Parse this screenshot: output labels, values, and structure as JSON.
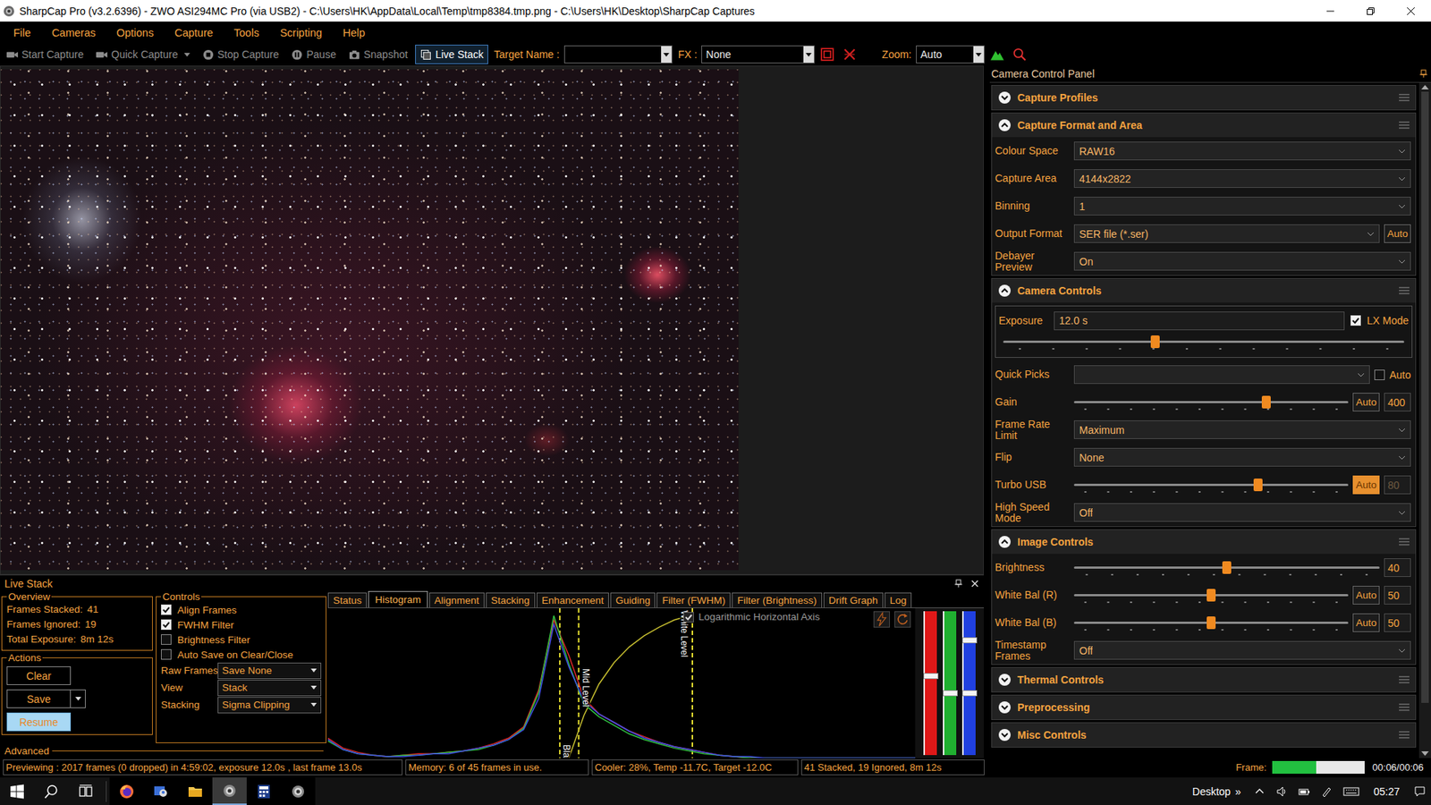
{
  "window": {
    "title": "SharpCap Pro (v3.2.6396) - ZWO ASI294MC Pro (via USB2) - C:\\Users\\HK\\AppData\\Local\\Temp\\tmp8384.tmp.png - C:\\Users\\HK\\Desktop\\SharpCap Captures"
  },
  "menu": [
    "File",
    "Cameras",
    "Options",
    "Capture",
    "Tools",
    "Scripting",
    "Help"
  ],
  "toolbar": {
    "buttons": [
      {
        "label": "Start Capture",
        "kind": "camera",
        "disabled": true,
        "selected": false,
        "dropdown": false
      },
      {
        "label": "Quick Capture",
        "kind": "camera",
        "disabled": true,
        "selected": false,
        "dropdown": true
      },
      {
        "label": "Stop Capture",
        "kind": "stop",
        "disabled": true,
        "selected": false,
        "dropdown": false
      },
      {
        "label": "Pause",
        "kind": "pause",
        "disabled": true,
        "selected": false,
        "dropdown": false
      },
      {
        "label": "Snapshot",
        "kind": "snapshot",
        "disabled": true,
        "selected": false,
        "dropdown": false
      },
      {
        "label": "Live Stack",
        "kind": "stack",
        "disabled": false,
        "selected": true,
        "dropdown": false
      }
    ],
    "target": {
      "label": "Target Name :",
      "value": ""
    },
    "fx": {
      "label": "FX :",
      "value": "None"
    },
    "zoom": {
      "label": "Zoom:",
      "value": "Auto"
    }
  },
  "control_panel": {
    "title": "Camera Control Panel",
    "scroll": {
      "level": 0.93
    },
    "sections": [
      {
        "title": "Capture Profiles",
        "expanded": false,
        "rows": []
      },
      {
        "title": "Capture Format and Area",
        "expanded": true,
        "rows": [
          {
            "kind": "select",
            "label": "Colour Space",
            "value": "RAW16"
          },
          {
            "kind": "select",
            "label": "Capture Area",
            "value": "4144x2822"
          },
          {
            "kind": "select",
            "label": "Binning",
            "value": "1"
          },
          {
            "kind": "select",
            "label": "Output Format",
            "value": "SER file (*.ser)",
            "button": "Auto"
          },
          {
            "kind": "select",
            "label": "Debayer Preview",
            "value": "On"
          }
        ]
      },
      {
        "title": "Camera Controls",
        "expanded": true,
        "rows": [
          {
            "kind": "exposure",
            "label": "Exposure",
            "value": "12.0 s",
            "check_label": "LX Mode",
            "checked": true,
            "level": 0.38
          },
          {
            "kind": "quickpicks",
            "label": "Quick Picks",
            "value": "",
            "check_label": "Auto",
            "checked": false
          },
          {
            "kind": "slider",
            "label": "Gain",
            "level": 0.7,
            "button": "Auto",
            "button_on": false,
            "value": "400",
            "disabled": false
          },
          {
            "kind": "select",
            "label": "Frame Rate Limit",
            "value": "Maximum"
          },
          {
            "kind": "select",
            "label": "Flip",
            "value": "None"
          },
          {
            "kind": "slider",
            "label": "Turbo USB",
            "level": 0.67,
            "button": "Auto",
            "button_on": true,
            "value": "80",
            "disabled": true
          },
          {
            "kind": "select",
            "label": "High Speed Mode",
            "value": "Off"
          }
        ]
      },
      {
        "title": "Image Controls",
        "expanded": true,
        "rows": [
          {
            "kind": "slider",
            "label": "Brightness",
            "level": 0.5,
            "value": "40",
            "disabled": false
          },
          {
            "kind": "slider",
            "label": "White Bal (R)",
            "level": 0.5,
            "button": "Auto",
            "button_on": false,
            "value": "50",
            "disabled": false
          },
          {
            "kind": "slider",
            "label": "White Bal (B)",
            "level": 0.5,
            "button": "Auto",
            "button_on": false,
            "value": "50",
            "disabled": false
          },
          {
            "kind": "select",
            "label": "Timestamp Frames",
            "value": "Off"
          }
        ]
      },
      {
        "title": "Thermal Controls",
        "expanded": false,
        "rows": []
      },
      {
        "title": "Preprocessing",
        "expanded": false,
        "rows": []
      },
      {
        "title": "Misc Controls",
        "expanded": false,
        "rows": []
      }
    ]
  },
  "live_stack": {
    "title": "Live Stack",
    "overview": {
      "title": "Overview",
      "lines": [
        {
          "label": "Frames Stacked:",
          "value": "41"
        },
        {
          "label": "Frames Ignored:",
          "value": "19"
        },
        {
          "label": "Total Exposure:",
          "value": "8m 12s"
        }
      ]
    },
    "actions": {
      "title": "Actions",
      "buttons": [
        {
          "label": "Clear",
          "dropdown": false,
          "highlighted": false
        },
        {
          "label": "Save",
          "dropdown": true,
          "highlighted": false
        },
        {
          "label": "Resume",
          "dropdown": false,
          "highlighted": true
        }
      ]
    },
    "controls": {
      "title": "Controls",
      "checks": [
        {
          "label": "Align Frames",
          "checked": true
        },
        {
          "label": "FWHM Filter",
          "checked": true
        },
        {
          "label": "Brightness Filter",
          "checked": false
        },
        {
          "label": "Auto Save on Clear/Close",
          "checked": false
        }
      ],
      "selects": [
        {
          "label": "Raw Frames",
          "value": "Save None"
        },
        {
          "label": "View",
          "value": "Stack"
        },
        {
          "label": "Stacking",
          "value": "Sigma Clipping"
        }
      ]
    },
    "advanced": "Advanced",
    "tabs": [
      {
        "label": "Status",
        "selected": false
      },
      {
        "label": "Histogram",
        "selected": true
      },
      {
        "label": "Alignment",
        "selected": false
      },
      {
        "label": "Stacking",
        "selected": false
      },
      {
        "label": "Enhancement",
        "selected": false
      },
      {
        "label": "Guiding",
        "selected": false
      },
      {
        "label": "Filter (FWHM)",
        "selected": false
      },
      {
        "label": "Filter (Brightness)",
        "selected": false
      },
      {
        "label": "Drift Graph",
        "selected": false
      },
      {
        "label": "Log",
        "selected": false
      }
    ],
    "histogram": {
      "log_axis": {
        "label": "Logarithmic Horizontal Axis",
        "checked": true
      },
      "series": [
        {
          "name": "red",
          "color": "#e02828",
          "values": [
            14,
            7,
            4,
            2,
            1,
            2,
            3,
            3,
            4,
            5,
            7,
            10,
            14,
            22,
            48,
            97,
            72,
            42,
            31,
            25,
            19,
            15,
            11,
            8,
            6,
            4,
            2,
            1,
            0,
            0,
            0,
            0,
            0,
            0,
            0,
            0,
            0,
            0,
            0,
            0
          ]
        },
        {
          "name": "green",
          "color": "#30c040",
          "values": [
            12,
            6,
            3,
            2,
            1,
            2,
            2,
            3,
            4,
            5,
            6,
            9,
            13,
            21,
            46,
            100,
            66,
            38,
            29,
            23,
            17,
            13,
            10,
            7,
            5,
            3,
            2,
            1,
            0,
            0,
            0,
            0,
            0,
            0,
            0,
            0,
            0,
            0,
            0,
            0
          ]
        },
        {
          "name": "blue",
          "color": "#4050e8",
          "values": [
            13,
            6,
            3,
            2,
            1,
            1,
            2,
            3,
            3,
            5,
            7,
            9,
            13,
            20,
            42,
            94,
            64,
            40,
            31,
            25,
            19,
            14,
            11,
            8,
            6,
            4,
            2,
            1,
            1,
            0,
            0,
            0,
            0,
            0,
            0,
            0,
            0,
            0,
            0,
            0
          ]
        }
      ],
      "transfer": {
        "color": "#c8c030",
        "values": [
          null,
          null,
          null,
          null,
          null,
          null,
          null,
          null,
          null,
          null,
          null,
          null,
          null,
          null,
          null,
          null,
          0,
          30,
          52,
          67,
          78,
          86,
          92,
          97,
          100,
          null,
          null,
          null,
          null,
          null,
          null,
          null,
          null,
          null,
          null,
          null,
          null,
          null,
          null,
          null
        ]
      },
      "markers": [
        {
          "label": "Bla",
          "position": 15.4
        },
        {
          "label": "Mid Level",
          "position": 16.65
        },
        {
          "label": "White Level",
          "position": 24.2
        }
      ],
      "channel_sliders": [
        {
          "color": "#e01818",
          "handles": [
            0.55
          ]
        },
        {
          "color": "#20b030",
          "handles": [
            0.43
          ]
        },
        {
          "color": "#2040e0",
          "handles": [
            0.8,
            0.43
          ]
        }
      ]
    }
  },
  "status_bar": {
    "segments": [
      "Previewing : 2017 frames (0 dropped) in 4:59:02, exposure 12.0s , last frame 13.0s",
      "Memory: 6 of 45 frames in use.",
      "Cooler: 28%, Temp -11.7C, Target -12.0C",
      "41 Stacked, 19 Ignored, 8m 12s"
    ],
    "frame": {
      "label": "Frame:",
      "level": 0.47,
      "text": "00:06/00:06"
    }
  },
  "taskbar": {
    "apps": [
      {
        "kind": "firefox",
        "active": false
      },
      {
        "kind": "people",
        "active": false
      },
      {
        "kind": "folder",
        "active": false
      },
      {
        "kind": "sharpcap",
        "active": true
      },
      {
        "kind": "calculator",
        "active": false
      },
      {
        "kind": "sharpcap",
        "active": false
      }
    ],
    "desktop": "Desktop",
    "chevron": "»",
    "time": "05:27"
  }
}
